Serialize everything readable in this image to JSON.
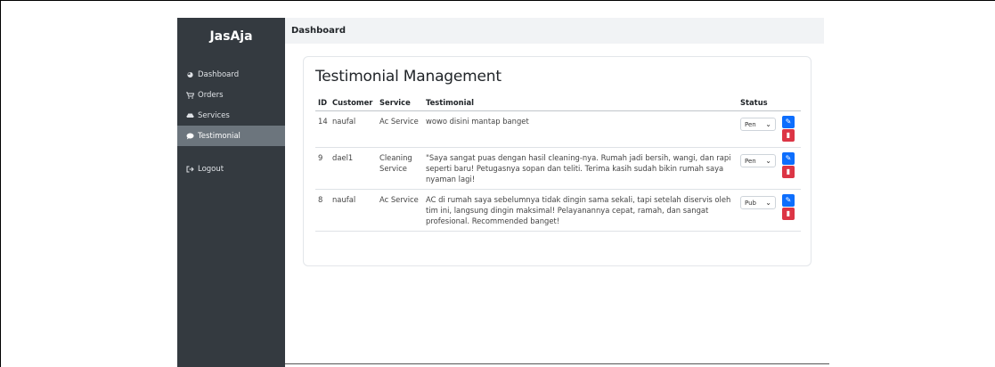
{
  "sidebar": {
    "brand": "JasAja",
    "items": [
      {
        "label": "Dashboard",
        "icon": "gauge-icon"
      },
      {
        "label": "Orders",
        "icon": "cart-icon"
      },
      {
        "label": "Services",
        "icon": "car-icon"
      },
      {
        "label": "Testimonial",
        "icon": "comment-icon"
      }
    ],
    "logout": {
      "label": "Logout",
      "icon": "logout-icon"
    }
  },
  "header": {
    "title": "Dashboard"
  },
  "main": {
    "title": "Testimonial Management",
    "columns": [
      "ID",
      "Customer",
      "Service",
      "Testimonial",
      "Status",
      ""
    ],
    "rows": [
      {
        "id": "14",
        "customer": "naufal",
        "service": "Ac Service",
        "testimonial": "wowo disini mantap banget",
        "status": "Pen"
      },
      {
        "id": "9",
        "customer": "dael1",
        "service": "Cleaning Service",
        "testimonial": "\"Saya sangat puas dengan hasil cleaning-nya. Rumah jadi bersih, wangi, dan rapi seperti baru! Petugasnya sopan dan teliti. Terima kasih sudah bikin rumah saya nyaman lagi!",
        "status": "Pen"
      },
      {
        "id": "8",
        "customer": "naufal",
        "service": "Ac Service",
        "testimonial": "AC di rumah saya sebelumnya tidak dingin sama sekali, tapi setelah diservis oleh tim ini, langsung dingin maksimal! Pelayanannya cepat, ramah, dan sangat profesional. Recommended banget!",
        "status": "Pub"
      }
    ]
  },
  "colors": {
    "sidebar": "#343a40",
    "active": "#6c757d",
    "edit": "#0d6efd",
    "delete": "#dc3545"
  }
}
